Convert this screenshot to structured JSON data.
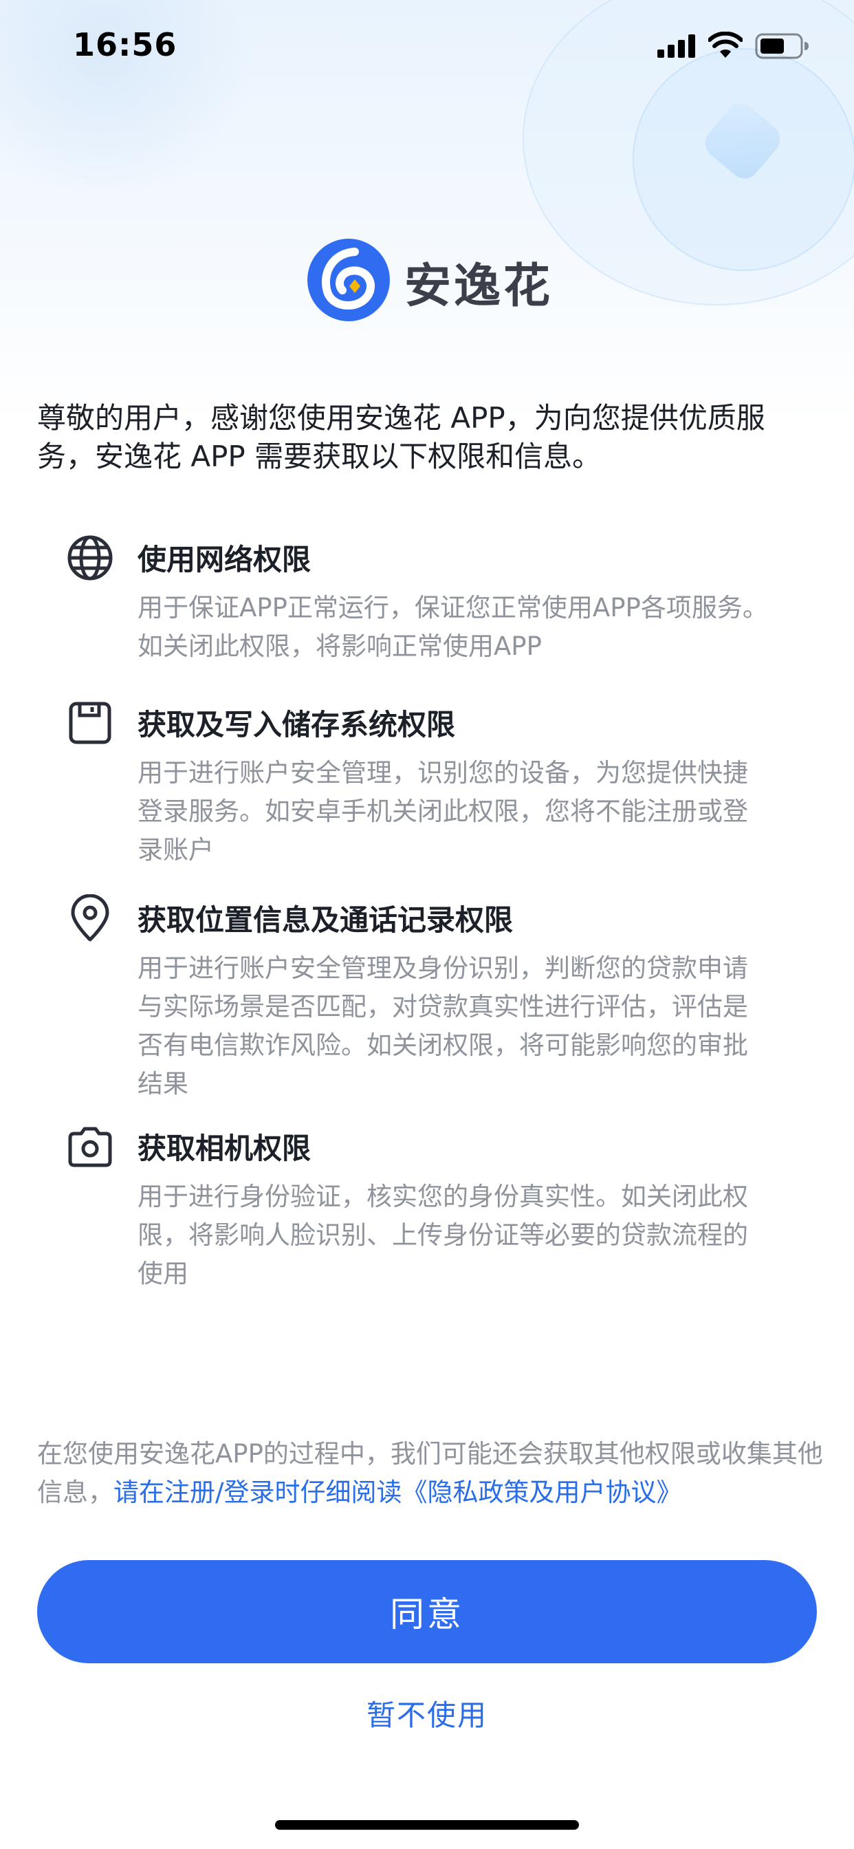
{
  "status_bar": {
    "time": "16:56",
    "icons": [
      "cellular-signal-icon",
      "wifi-icon",
      "battery-icon"
    ]
  },
  "brand": {
    "name": "安逸花",
    "logo_color": "#2f6cf0",
    "logo_accent": "#f5b500"
  },
  "intro_text": "尊敬的用户，感谢您使用安逸花 APP，为向您提供优质服务，安逸花 APP 需要获取以下权限和信息。",
  "permissions": [
    {
      "icon": "globe-icon",
      "title": "使用网络权限",
      "description": "用于保证APP正常运行，保证您正常使用APP各项服务。如关闭此权限，将影响正常使用APP"
    },
    {
      "icon": "storage-icon",
      "title": "获取及写入储存系统权限",
      "description": "用于进行账户安全管理，识别您的设备，为您提供快捷登录服务。如安卓手机关闭此权限，您将不能注册或登录账户"
    },
    {
      "icon": "location-pin-icon",
      "title": "获取位置信息及通话记录权限",
      "description": "用于进行账户安全管理及身份识别，判断您的贷款申请与实际场景是否匹配，对贷款真实性进行评估，评估是否有电信欺诈风险。如关闭权限，将可能影响您的审批结果"
    },
    {
      "icon": "camera-icon",
      "title": "获取相机权限",
      "description": "用于进行身份验证，核实您的身份真实性。如关闭此权限，将影响人脸识别、上传身份证等必要的贷款流程的使用"
    }
  ],
  "notice": {
    "text": "在您使用安逸花APP的过程中，我们可能还会获取其他权限或收集其他信息，",
    "link": "请在注册/登录时仔细阅读《隐私政策及用户协议》"
  },
  "buttons": {
    "agree": "同意",
    "decline": "暂不使用"
  },
  "colors": {
    "primary": "#2f6cf0",
    "link": "#2a6de8",
    "body_text": "#1c2028",
    "secondary_text": "#8e939c"
  }
}
